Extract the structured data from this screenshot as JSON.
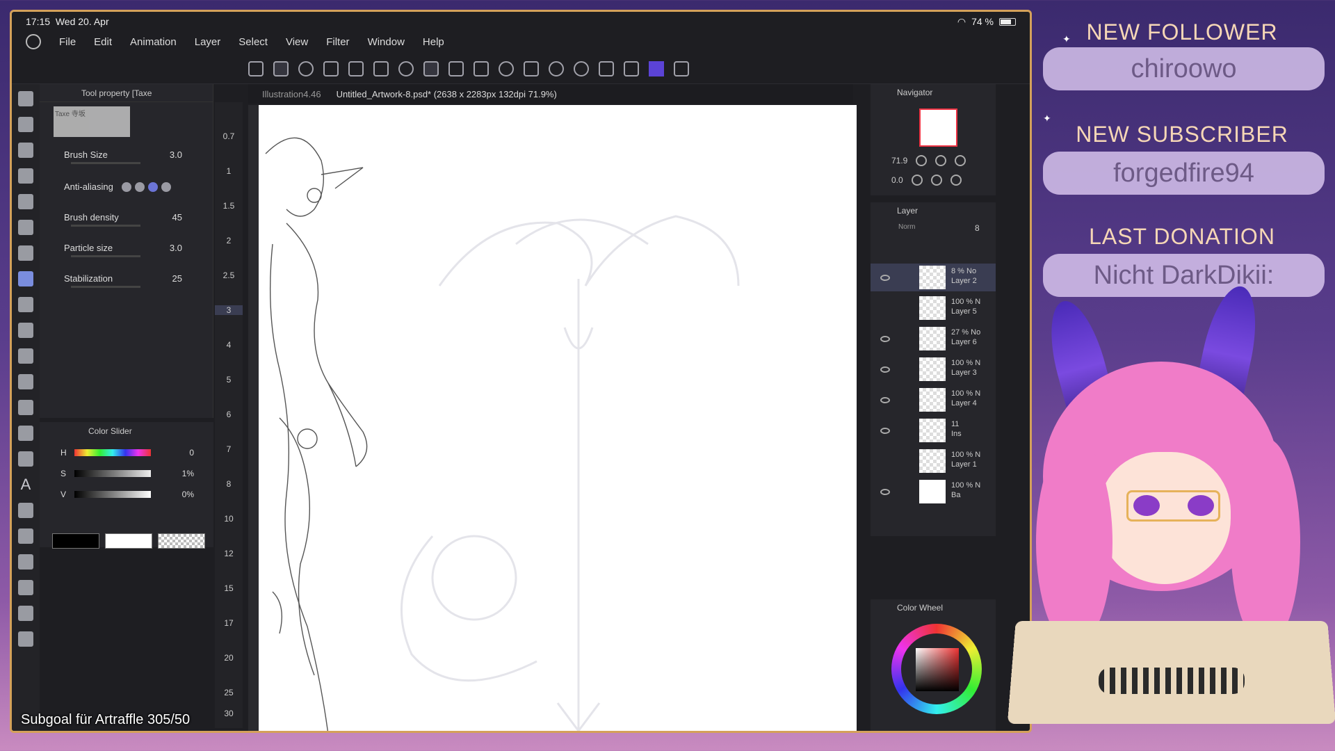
{
  "status": {
    "time": "17:15",
    "date": "Wed 20. Apr",
    "battery": "74 %"
  },
  "menu": [
    "File",
    "Edit",
    "Animation",
    "Layer",
    "Select",
    "View",
    "Filter",
    "Window",
    "Help"
  ],
  "tabs": {
    "inactive": "Illustration4.46",
    "active": "Untitled_Artwork-8.psd* (2638 x 2283px 132dpi 71.9%)"
  },
  "tool_property": {
    "title": "Tool property [Taxe",
    "preview_label": "Taxe 寺坂",
    "brush_size_label": "Brush Size",
    "brush_size": "3.0",
    "anti_aliasing_label": "Anti-aliasing",
    "brush_density_label": "Brush density",
    "brush_density": "45",
    "particle_size_label": "Particle size",
    "particle_size": "3.0",
    "stabilization_label": "Stabilization",
    "stabilization": "25"
  },
  "brush_sizes": [
    "0.7",
    "1",
    "1.5",
    "2",
    "2.5",
    "3",
    "4",
    "5",
    "6",
    "7",
    "8",
    "10",
    "12",
    "15",
    "17",
    "20",
    "25",
    "30"
  ],
  "color_slider": {
    "title": "Color Slider",
    "h_label": "H",
    "h_value": "0",
    "s_label": "S",
    "s_value": "1%",
    "v_label": "V",
    "v_value": "0%"
  },
  "navigator": {
    "title": "Navigator",
    "zoom": "71.9",
    "rotation": "0.0"
  },
  "layer_panel": {
    "title": "Layer",
    "blend": "Norm",
    "opacity": "8",
    "layers": [
      {
        "opacity": "8 % No",
        "name": "Layer 2"
      },
      {
        "opacity": "100 % N",
        "name": "Layer 5"
      },
      {
        "opacity": "27 % No",
        "name": "Layer 6"
      },
      {
        "opacity": "100 % N",
        "name": "Layer 3"
      },
      {
        "opacity": "100 % N",
        "name": "Layer 4"
      },
      {
        "opacity": "11",
        "name": "Ins"
      },
      {
        "opacity": "100 % N",
        "name": "Layer 1"
      },
      {
        "opacity": "100 % N",
        "name": "Ba"
      }
    ]
  },
  "color_wheel": {
    "title": "Color Wheel"
  },
  "subgoal": "Subgoal für Artraffle 305/50",
  "overlay": {
    "follower_title": "NEW FOLLOWER",
    "follower_name": "chiroowo",
    "subscriber_title": "NEW SUBSCRIBER",
    "subscriber_name": "forgedfire94",
    "donation_title": "LAST DONATION",
    "donation_name": "Nicht DarkDikii:"
  },
  "colors": {
    "frame": "#d4a15a",
    "accent": "#5b43d6",
    "overlay_title": "#f6d7b6"
  }
}
